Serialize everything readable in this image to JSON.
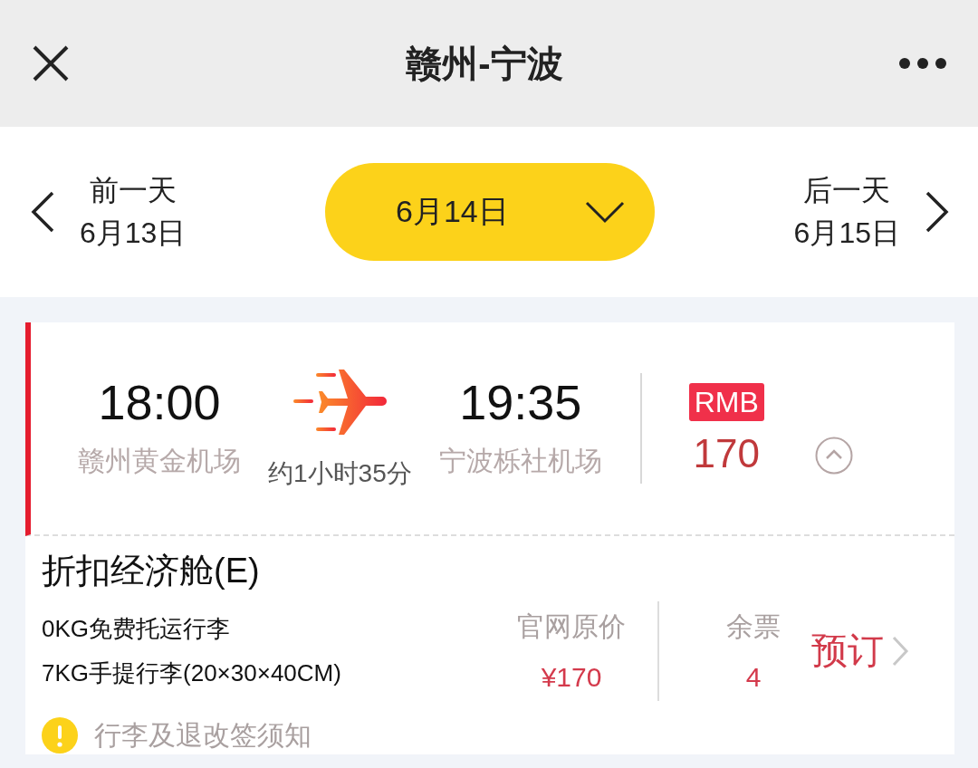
{
  "header": {
    "title": "赣州-宁波"
  },
  "date_bar": {
    "previous": {
      "label": "前一天",
      "date": "6月13日"
    },
    "current": {
      "date": "6月14日",
      "expanded": false
    },
    "next": {
      "label": "后一天",
      "date": "6月15日"
    }
  },
  "flight": {
    "depart_time": "18:00",
    "depart_airport": "赣州黄金机场",
    "duration": "约1小时35分",
    "arrive_time": "19:35",
    "arrive_airport": "宁波栎社机场",
    "currency": "RMB",
    "price": "170",
    "expanded": true,
    "fares": [
      {
        "cabin": "折扣经济舱(E)",
        "baggage": [
          "0KG免费托运行李",
          "7KG手提行李(20×30×40CM)"
        ],
        "official_label": "官网原价",
        "official_price": "¥170",
        "seats_label": "余票",
        "seats": "4",
        "book": "预订",
        "notice": "行李及退改签须知"
      }
    ]
  }
}
